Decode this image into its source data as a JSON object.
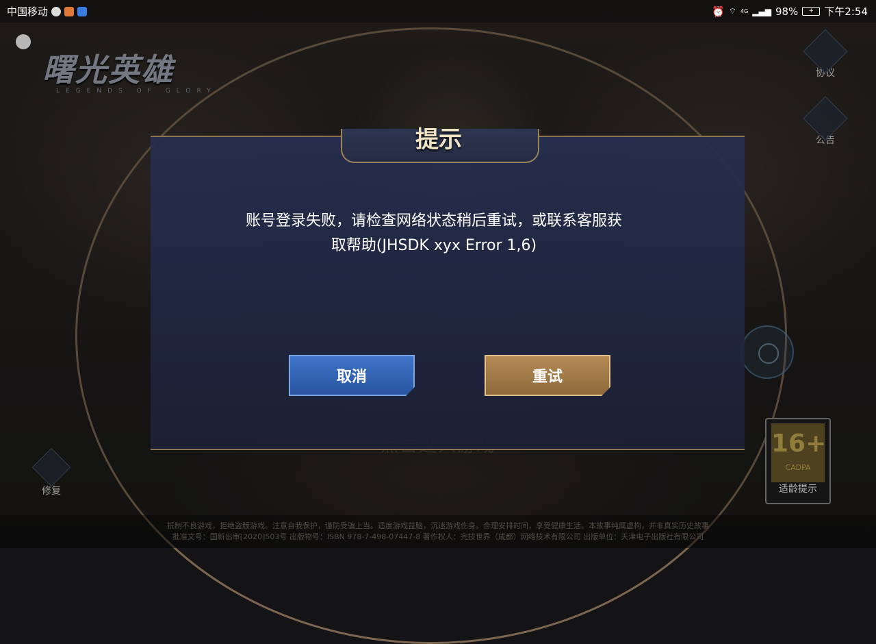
{
  "status_bar": {
    "carrier": "中国移动",
    "battery": "98%",
    "time": "下午2:54",
    "network": "4G"
  },
  "game": {
    "logo_title": "曙光英雄",
    "logo_subtitle": "LEGENDS OF GLORY",
    "enter_prompt": "点击进入游戏"
  },
  "side": {
    "agreement_label": "协议",
    "notice_label": "公告",
    "repair_label": "修复",
    "age_rating": "16+",
    "age_org": "CADPA",
    "age_tip": "适龄提示"
  },
  "dialog": {
    "title": "提示",
    "message_line1": "账号登录失败，请检查网络状态稍后重试，或联系客服获",
    "message_line2": "取帮助(JHSDK xyx Error 1,6)",
    "cancel_label": "取消",
    "retry_label": "重试"
  },
  "footer": {
    "line1": "抵制不良游戏，拒绝盗版游戏。注意自我保护，谨防受骗上当。适度游戏益脑，沉迷游戏伤身。合理安排时间，享受健康生活。本故事纯属虚构，并非真实历史故事",
    "line2": "批准文号：国新出审[2020]503号  出版物号：ISBN 978-7-498-07447-8  著作权人：完技世界（成都）网络技术有限公司  出版单位：天津电子出版社有限公司"
  },
  "colors": {
    "accent_gold": "#9c8258",
    "cancel_blue": "#3f74c8",
    "retry_bronze": "#b48a54"
  }
}
